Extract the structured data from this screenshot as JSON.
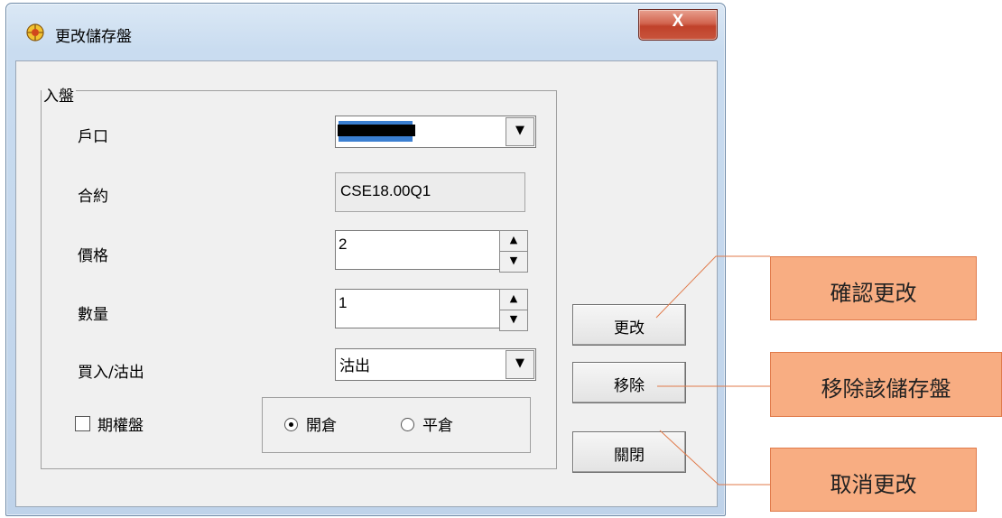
{
  "window": {
    "title": "更改儲存盤",
    "close_label": "X"
  },
  "group": {
    "legend": "入盤"
  },
  "form": {
    "account_label": "戶口",
    "account_value": "",
    "contract_label": "合約",
    "contract_value": "CSE18.00Q1",
    "price_label": "價格",
    "price_value": "2",
    "quantity_label": "數量",
    "quantity_value": "1",
    "side_label": "買入/沽出",
    "side_value": "沽出",
    "option_checkbox_label": "期權盤",
    "option_checked": false,
    "radio_open_label": "開倉",
    "radio_close_label": "平倉",
    "radio_selected": "open"
  },
  "buttons": {
    "modify": "更改",
    "remove": "移除",
    "close": "關閉"
  },
  "callouts": {
    "modify": "確認更改",
    "remove": "移除該儲存盤",
    "close": "取消更改"
  },
  "icons": {
    "app": "app-icon",
    "dropdown": "chevron-down-icon",
    "spin_up": "spin-up-icon",
    "spin_down": "spin-down-icon"
  },
  "colors": {
    "callout_fill": "#f8ad82",
    "callout_border": "#e07a4a",
    "close_button": "#c8553d"
  }
}
